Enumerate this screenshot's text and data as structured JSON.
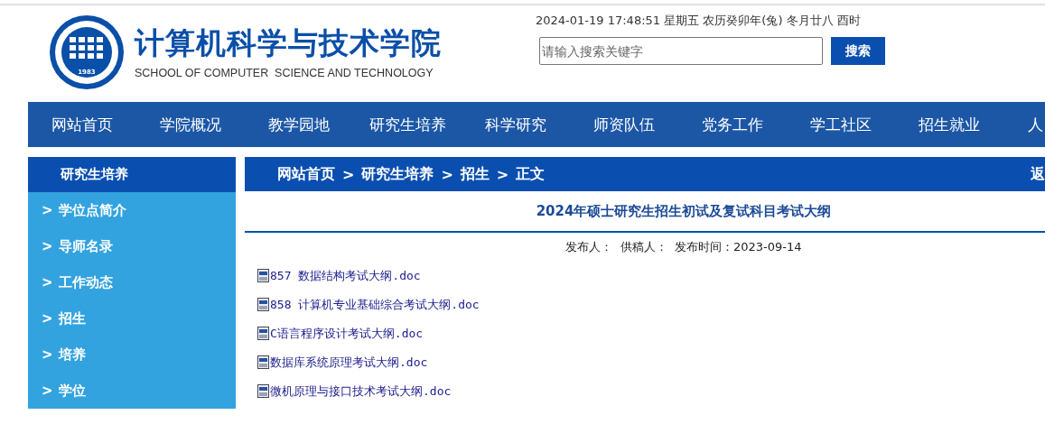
{
  "header": {
    "logo_year": "1983",
    "title": "计算机科学与技术学院",
    "subtitle": "SCHOOL OF COMPUTER  SCIENCE AND TECHNOLOGY",
    "datetime": "2024-01-19 17:48:51 星期五 农历癸卯年(兔) 冬月廿八 酉时",
    "search": {
      "placeholder": "请输入搜索关键字",
      "button": "搜索"
    }
  },
  "nav": [
    "网站首页",
    "学院概况",
    "教学园地",
    "研究生培养",
    "科学研究",
    "师资队伍",
    "党务工作",
    "学工社区",
    "招生就业",
    "人"
  ],
  "sidebar": {
    "title": "研究生培养",
    "items": [
      {
        "chevron": ">",
        "label": "学位点简介"
      },
      {
        "chevron": ">",
        "label": "导师名录"
      },
      {
        "chevron": ">",
        "label": "工作动态"
      },
      {
        "chevron": ">",
        "label": "招生"
      },
      {
        "chevron": ">",
        "label": "培养"
      },
      {
        "chevron": ">",
        "label": "学位"
      }
    ]
  },
  "breadcrumb": {
    "items": [
      "网站首页",
      "研究生培养",
      "招生",
      "正文"
    ],
    "separator": ">",
    "back": "返"
  },
  "article": {
    "title": "2024年硕士研究生招生初试及复试科目考试大纲",
    "meta": "发布人：  供稿人：  发布时间：2023-09-14",
    "attachments": [
      "857 数据结构考试大纲.doc",
      "858 计算机专业基础综合考试大纲.doc",
      "C语言程序设计考试大纲.doc",
      "数据库系统原理考试大纲.doc",
      "微机原理与接口技术考试大纲.doc"
    ]
  }
}
